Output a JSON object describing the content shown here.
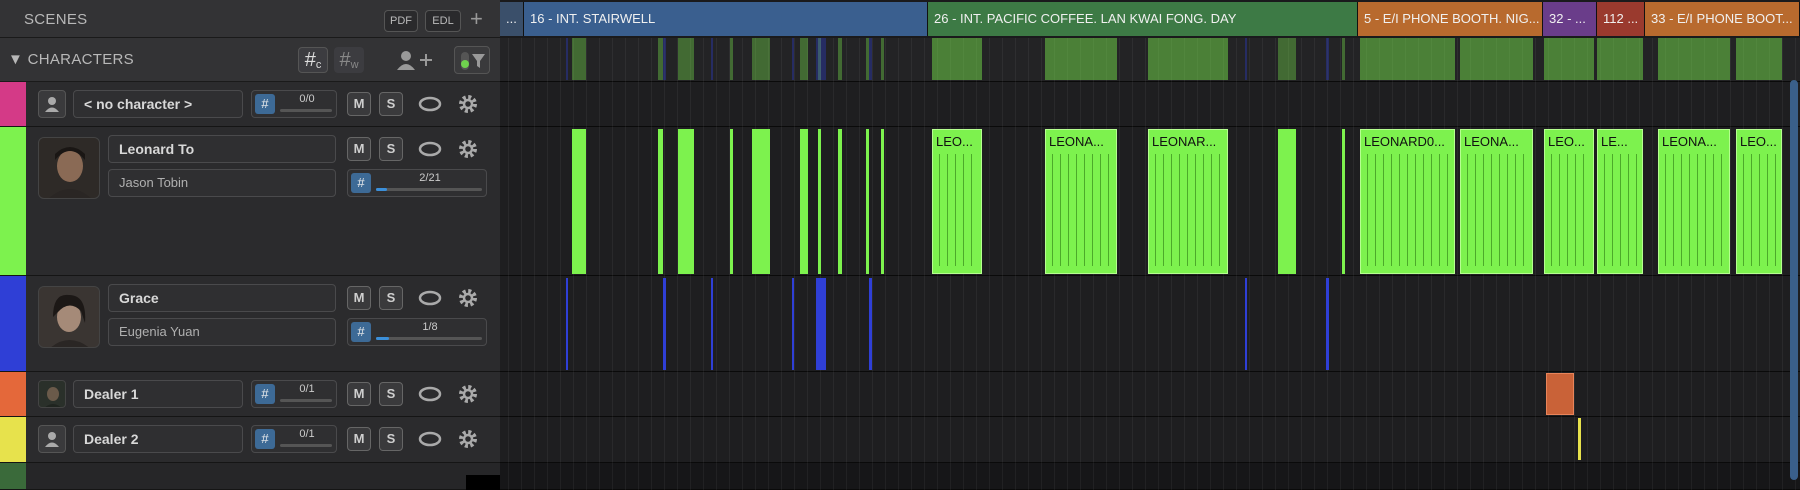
{
  "left": {
    "scenes_title": "SCENES",
    "pdf": "PDF",
    "edl": "EDL",
    "plus": "+",
    "characters_title": "▼ CHARACTERS",
    "hash_c": "#",
    "hash_c_sub": "c",
    "hash_w": "#",
    "hash_w_sub": "w"
  },
  "characters": [
    {
      "name": "< no character >",
      "count": "0/0",
      "ratio": 0,
      "color": "#d43a87"
    },
    {
      "name": "Leonard To",
      "actor": "Jason Tobin",
      "count": "2/21",
      "ratio": 0.1,
      "color": "#7df24e"
    },
    {
      "name": "Grace",
      "actor": "Eugenia Yuan",
      "count": "1/8",
      "ratio": 0.12,
      "color": "#2f3fd6"
    },
    {
      "name": "Dealer 1",
      "count": "0/1",
      "ratio": 0,
      "color": "#e4683a"
    },
    {
      "name": "Dealer 2",
      "count": "0/1",
      "ratio": 0,
      "color": "#e7e24c"
    }
  ],
  "buttons": {
    "m": "M",
    "s": "S"
  },
  "scenes": [
    {
      "label": "...",
      "color": "#3a4f6a"
    },
    {
      "label": "16 - INT. STAIRWELL",
      "color": "#3a5f8f"
    },
    {
      "label": "26 - INT. PACIFIC COFFEE. LAN KWAI FONG. DAY",
      "color": "#3d7a45"
    },
    {
      "label": "5 - E/I PHONE BOOTH. NIG...",
      "color": "#b86a2e"
    },
    {
      "label": "32 - ...",
      "color": "#6a3d8a"
    },
    {
      "label": "112 ...",
      "color": "#9a3a2e"
    },
    {
      "label": "33 - E/I PHONE BOOT...",
      "color": "#b86a2e"
    }
  ],
  "leonard_labels": [
    "LEO...",
    "LEONA...",
    "LEONAR...",
    "LEONARD0...",
    "LEONA...",
    "LEO...",
    "LE...",
    "LEONA...",
    "LEO..."
  ],
  "colors": {
    "leonard_block": "#7df24e",
    "grace_block": "#2f3fd6",
    "dealer1_block": "#d9683a",
    "dealer2_block": "#e7e24c"
  }
}
